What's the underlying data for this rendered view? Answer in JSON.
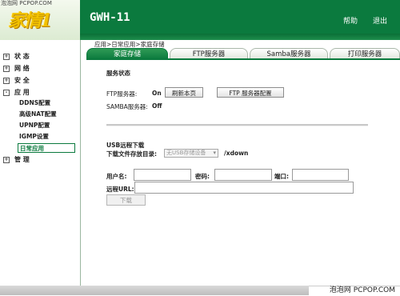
{
  "watermark_top": "泡泡网 PCPOP.COM",
  "watermark_bottom": "泡泡网 PCPOP.COM",
  "header": {
    "logo_text": "家情1",
    "model": "GWH-11",
    "help_link": "帮助",
    "logout_link": "退出"
  },
  "sidebar": {
    "status": "状 态",
    "network": "网 络",
    "security": "安 全",
    "applications": "应 用",
    "sub_items": [
      "DDNS配置",
      "高级NAT配置",
      "UPNP配置",
      "IGMP设置",
      "日常应用"
    ],
    "management": "管 理",
    "expanded_marker": "-",
    "collapsed_marker": "+"
  },
  "breadcrumb": "应用>日常应用>家庭存储",
  "tabs": [
    "家庭存储",
    "FTP服务器",
    "Samba服务器",
    "打印服务器"
  ],
  "service_status": {
    "heading": "服务状态",
    "ftp_label": "FTP服务器:",
    "ftp_value": "On",
    "refresh_button": "刷新本页",
    "ftp_config_button": "FTP 服务器配置",
    "samba_label": "SAMBA服务器:",
    "samba_value": "Off"
  },
  "usb_download": {
    "heading": "USB远程下载",
    "save_dir_label": "下载文件存放目录:",
    "save_dir_selected": "无USB存储设备",
    "save_dir_suffix": "/xdown",
    "username_label": "用户名:",
    "username_value": "",
    "password_label": "密码:",
    "password_value": "",
    "port_label": "端口:",
    "port_value": "",
    "url_label": "远程URL:",
    "url_value": "",
    "download_button": "下载"
  },
  "colors": {
    "brand_green": "#0b7a3e",
    "logo_yellow": "#f2c200"
  }
}
